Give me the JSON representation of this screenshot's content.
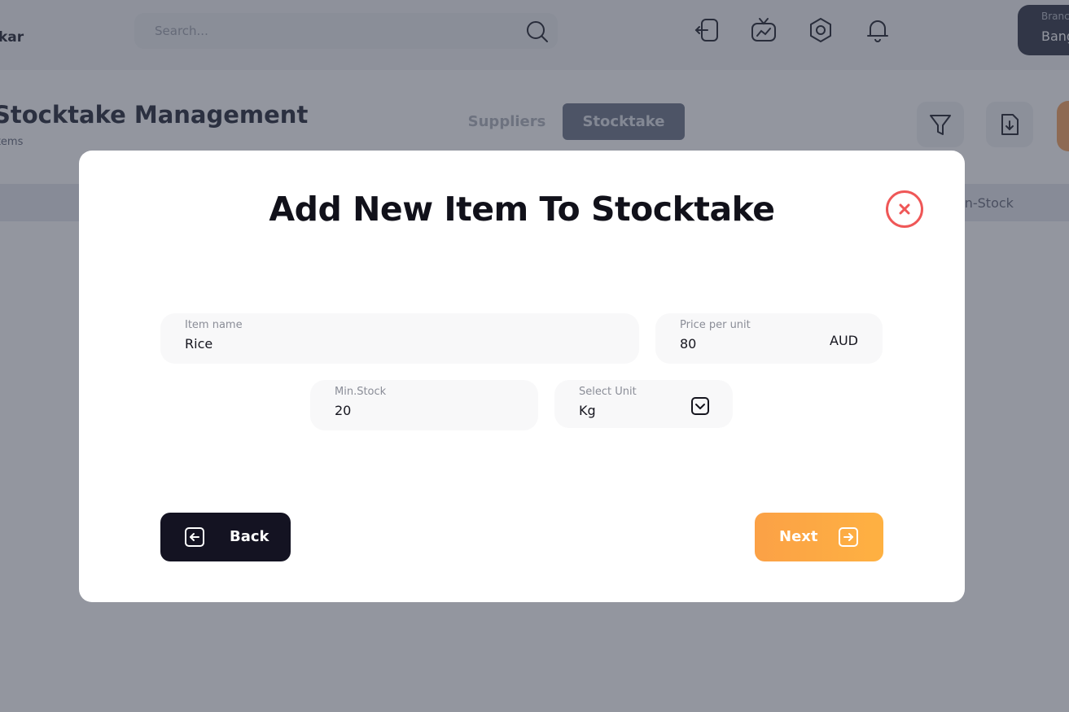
{
  "app": {
    "brand_fragment": "kar",
    "search_placeholder": "Search...",
    "branch": {
      "label": "Branch",
      "value": "Bangalore"
    }
  },
  "page": {
    "title": "Stocktake Management",
    "subtitle": "Items",
    "tabs": [
      {
        "label": "Suppliers",
        "active": false
      },
      {
        "label": "Stocktake",
        "active": true
      }
    ],
    "table_header_visible": "In-Stock"
  },
  "modal": {
    "title": "Add New Item To Stocktake",
    "fields": {
      "item_name": {
        "label": "Item name",
        "value": "Rice"
      },
      "price_per_unit": {
        "label": "Price per unit",
        "value": "80",
        "currency": "AUD"
      },
      "min_stock": {
        "label": "Min.Stock",
        "value": "20"
      },
      "unit": {
        "label": "Select Unit",
        "value": "Kg"
      }
    },
    "buttons": {
      "back": "Back",
      "next": "Next"
    }
  },
  "colors": {
    "close": "#ef5757",
    "back_button": "#141322",
    "next_button": "#fba146"
  },
  "icons": [
    "search-icon",
    "logout-icon",
    "tv-chart-icon",
    "settings-icon",
    "bell-icon",
    "filter-icon",
    "download-file-icon",
    "close-icon",
    "chevron-down-icon",
    "arrow-left-box-icon",
    "arrow-right-box-icon"
  ]
}
